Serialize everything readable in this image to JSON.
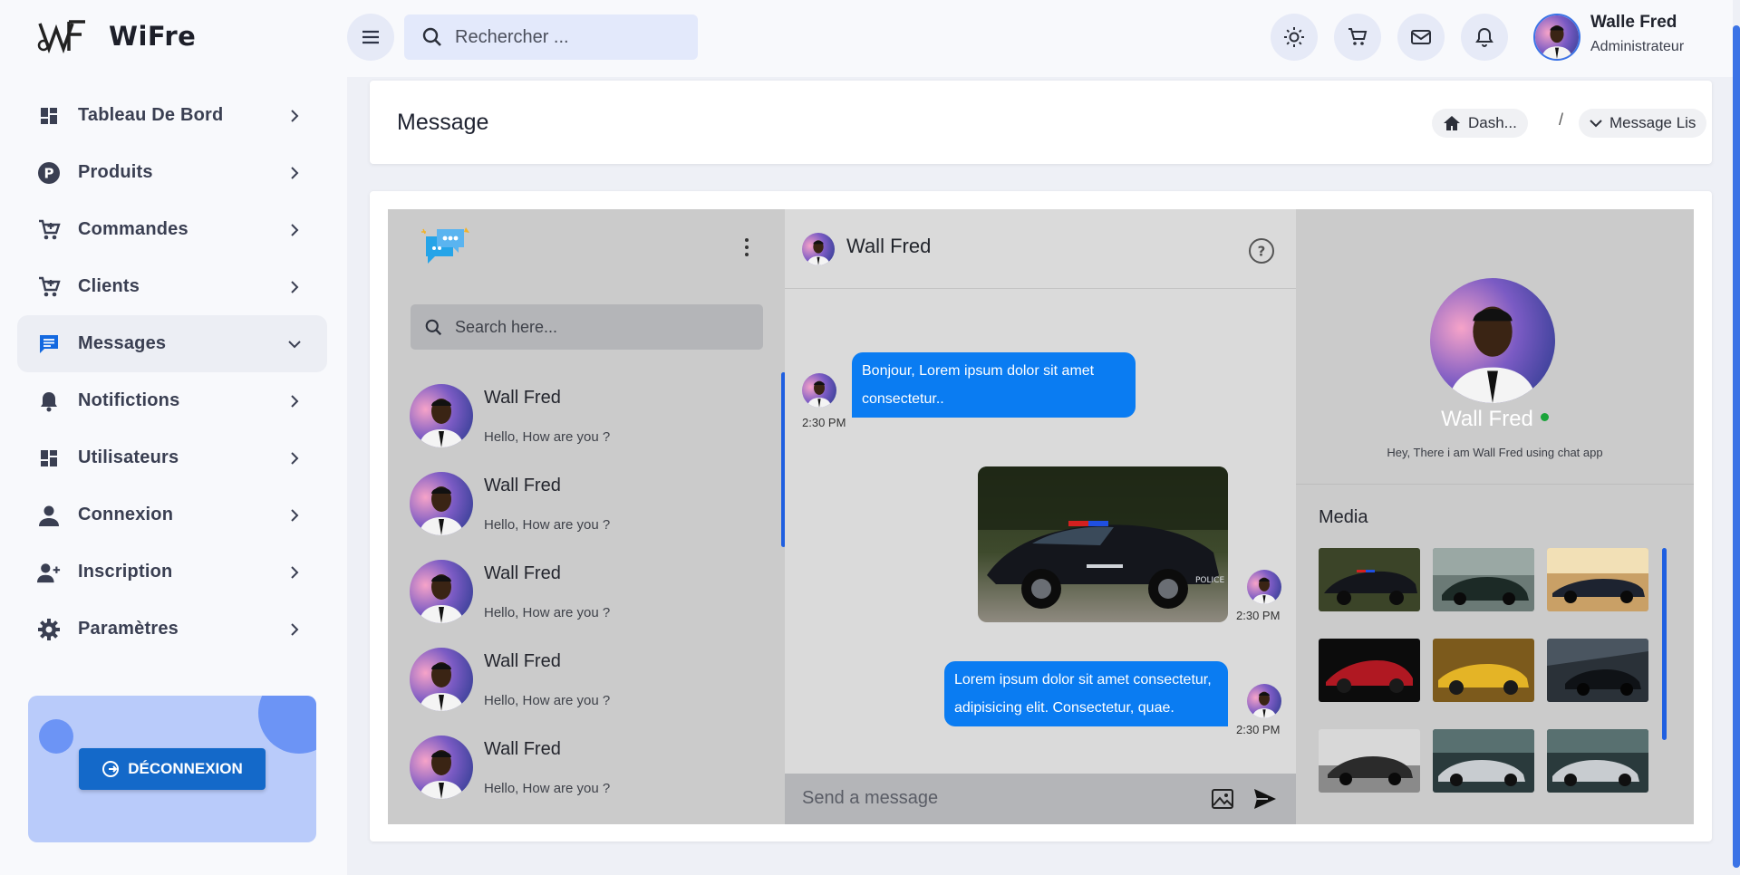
{
  "brand": {
    "name": "WiFre"
  },
  "sidebar": {
    "items": [
      {
        "label": "Tableau De Bord",
        "icon": "dashboard-icon",
        "active": false
      },
      {
        "label": "Produits",
        "icon": "product-p-icon",
        "active": false
      },
      {
        "label": "Commandes",
        "icon": "cart-icon",
        "active": false
      },
      {
        "label": "Clients",
        "icon": "cart-icon",
        "active": false
      },
      {
        "label": "Messages",
        "icon": "message-icon",
        "active": true
      },
      {
        "label": "Notifictions",
        "icon": "bell-icon",
        "active": false
      },
      {
        "label": "Utilisateurs",
        "icon": "dashboard-icon",
        "active": false
      },
      {
        "label": "Connexion",
        "icon": "person-icon",
        "active": false
      },
      {
        "label": "Inscription",
        "icon": "person-add-icon",
        "active": false
      },
      {
        "label": "Paramètres",
        "icon": "gear-icon",
        "active": false
      }
    ],
    "logout_label": "DÉCONNEXION"
  },
  "header": {
    "search_placeholder": "Rechercher ...",
    "user_name": "Walle Fred",
    "user_role": "Administrateur"
  },
  "page": {
    "title": "Message",
    "breadcrumb": [
      "Dash...",
      "Message Lis"
    ],
    "breadcrumb_sep": "/"
  },
  "chat": {
    "search_placeholder": "Search here...",
    "contacts": [
      {
        "name": "Wall Fred",
        "message": "Hello, How are you ?"
      },
      {
        "name": "Wall Fred",
        "message": "Hello, How are you ?"
      },
      {
        "name": "Wall Fred",
        "message": "Hello, How are you ?"
      },
      {
        "name": "Wall Fred",
        "message": "Hello, How are you ?"
      },
      {
        "name": "Wall Fred",
        "message": "Hello, How are you ?"
      }
    ],
    "active_contact": "Wall Fred",
    "messages": [
      {
        "text": "Bonjour, Lorem ipsum dolor sit amet consectetur..",
        "time": "2:30 PM"
      },
      {
        "text": "",
        "time": "2:30 PM",
        "image": "police-car"
      },
      {
        "text": "Lorem ipsum dolor sit amet consectetur, adipisicing elit. Consectetur, quae.",
        "time": "2:30 PM"
      }
    ],
    "send_placeholder": "Send a message"
  },
  "profile": {
    "name": "Wall Fred",
    "status": "Hey, There i am Wall Fred using chat app",
    "media_title": "Media"
  },
  "colors": {
    "accent": "#0a7cf2",
    "logout": "#1469c9",
    "online": "#1aa43a"
  }
}
